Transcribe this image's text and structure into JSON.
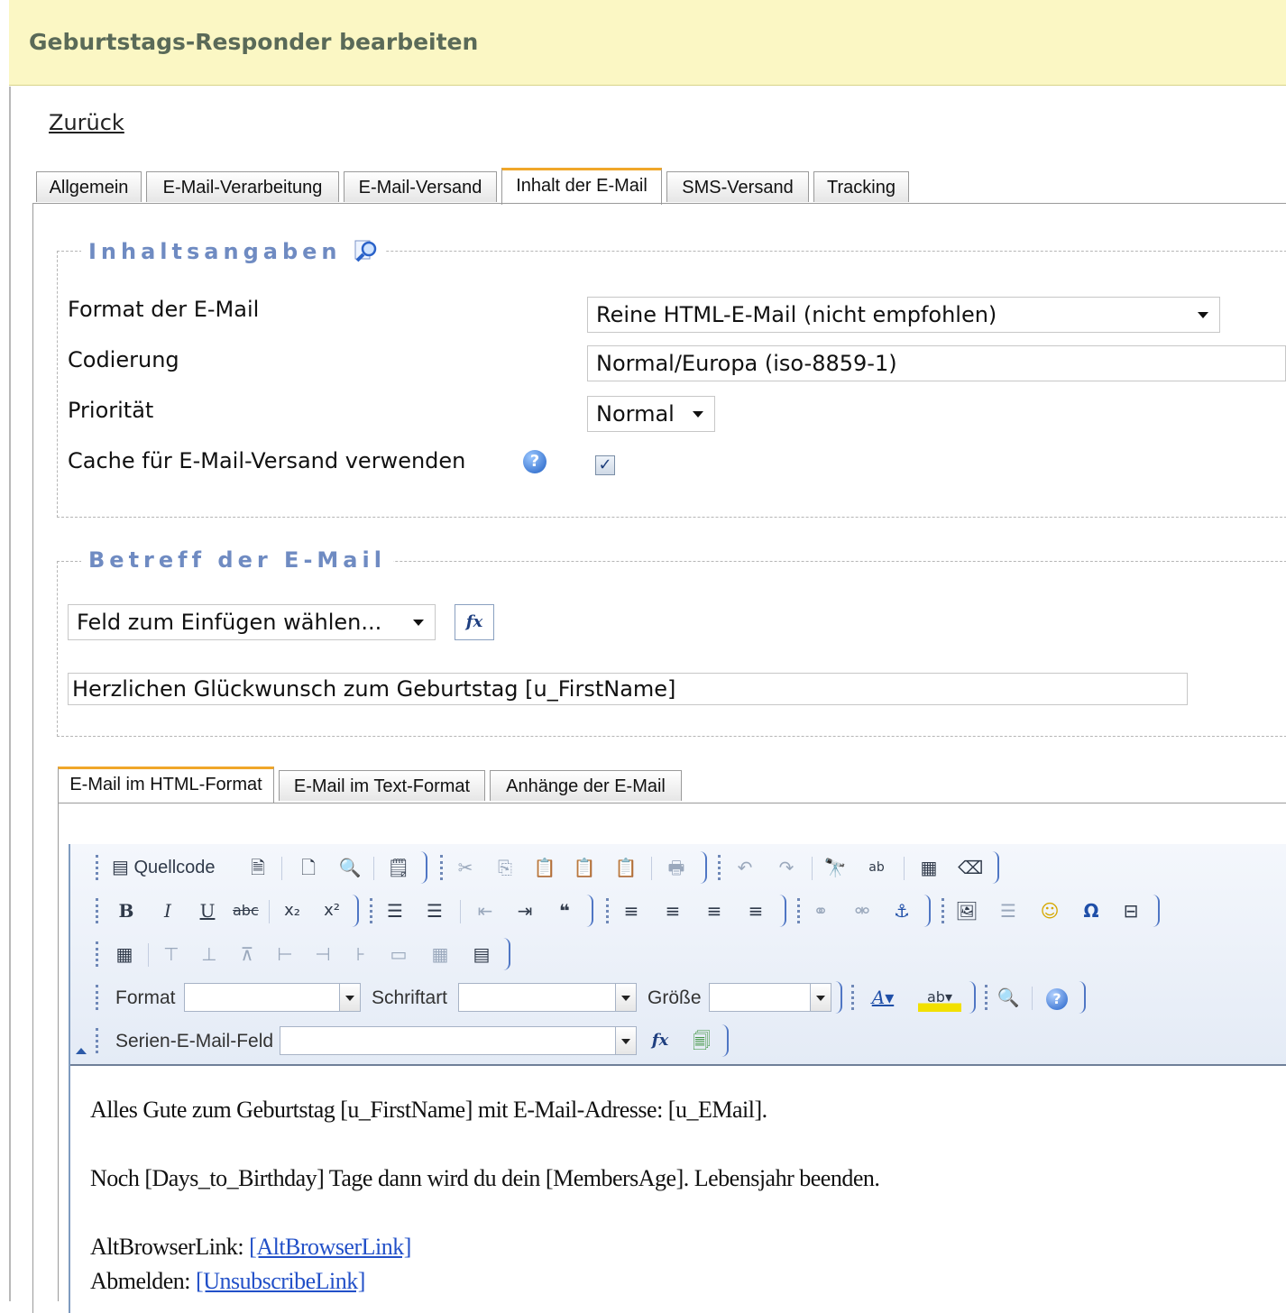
{
  "header": {
    "title": "Geburtstags-Responder bearbeiten"
  },
  "nav": {
    "back": "Zurück"
  },
  "main_tabs": [
    {
      "label": "Allgemein"
    },
    {
      "label": "E-Mail-Verarbeitung"
    },
    {
      "label": "E-Mail-Versand"
    },
    {
      "label": "Inhalt der E-Mail",
      "active": true
    },
    {
      "label": "SMS-Versand"
    },
    {
      "label": "Tracking"
    }
  ],
  "inhaltsangaben": {
    "legend": "Inhaltsangaben",
    "format_label": "Format der E-Mail",
    "format_value": "Reine HTML-E-Mail (nicht empfohlen)",
    "codierung_label": "Codierung",
    "codierung_value": "Normal/Europa (iso-8859-1)",
    "prioritaet_label": "Priorität",
    "prioritaet_value": "Normal",
    "cache_label": "Cache für E-Mail-Versand verwenden",
    "cache_checked": true
  },
  "betreff": {
    "legend": "Betreff der E-Mail",
    "field_select": "Feld zum Einfügen wählen...",
    "fx": "fx",
    "subject_value": "Herzlichen Glückwunsch zum Geburtstag [u_FirstName]"
  },
  "content_tabs": [
    {
      "label": "E-Mail im HTML-Format",
      "active": true
    },
    {
      "label": "E-Mail im Text-Format"
    },
    {
      "label": "Anhänge der E-Mail"
    }
  ],
  "editor_toolbar": {
    "source_label": "Quellcode",
    "format_label": "Format",
    "font_label": "Schriftart",
    "size_label": "Größe",
    "merge_field_label": "Serien-E-Mail-Feld",
    "fx": "fx"
  },
  "editor_content": {
    "line1": "Alles Gute zum Geburtstag [u_FirstName] mit E-Mail-Adresse: [u_EMail].",
    "line2": "Noch [Days_to_Birthday] Tage dann wird du dein [MembersAge]. Lebensjahr beenden.",
    "line3_label": "AltBrowserLink: ",
    "line3_link": "[AltBrowserLink]",
    "line4_label": "Abmelden: ",
    "line4_link": "[UnsubscribeLink]"
  },
  "colors": {
    "header_bg": "#fbf7c4",
    "legend": "#6f8bc2",
    "active_tab_accent": "#f0a72a",
    "link": "#2250c8"
  }
}
